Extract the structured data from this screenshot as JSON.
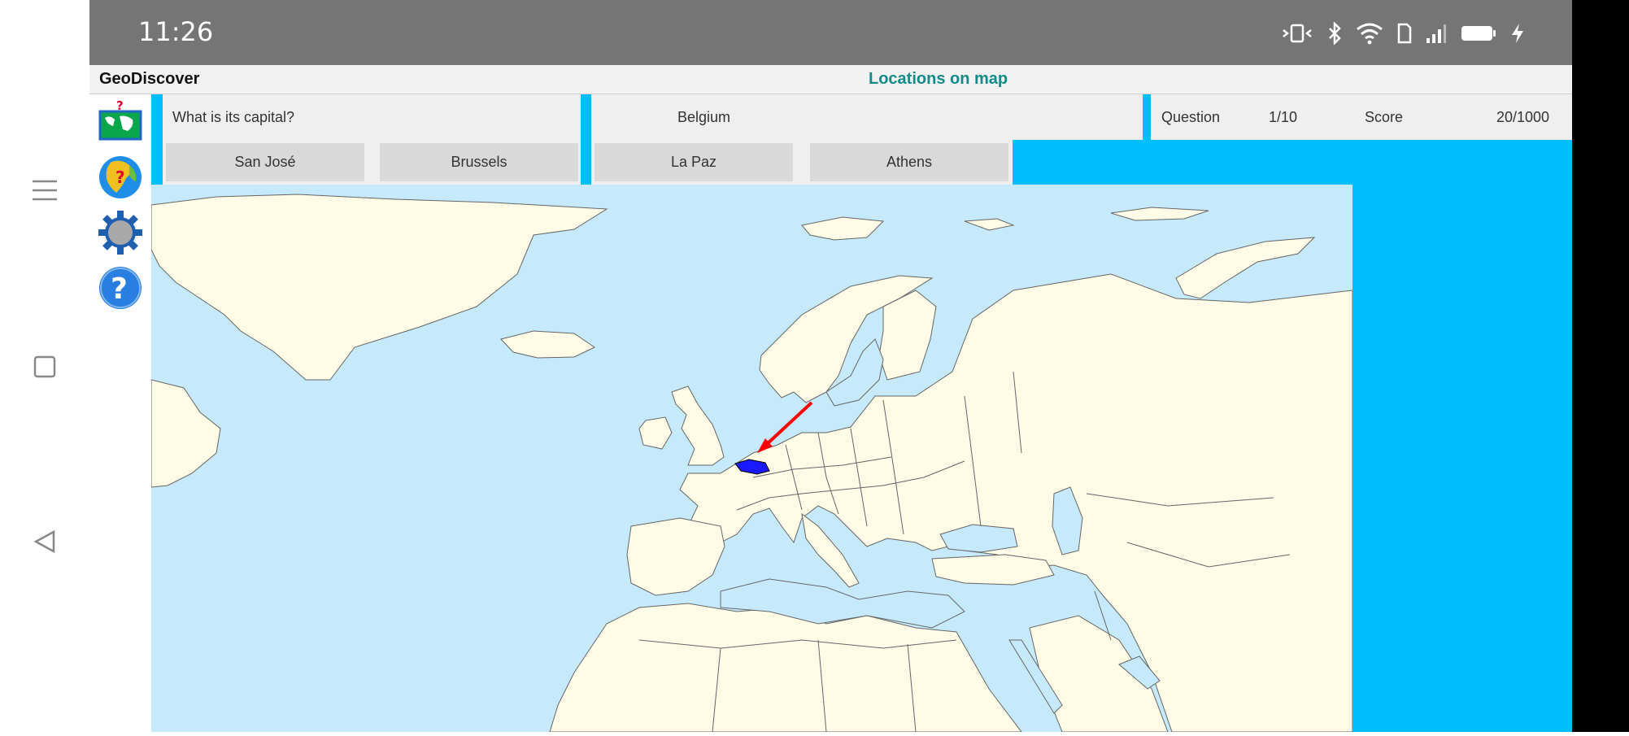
{
  "status_bar": {
    "time": "11:26",
    "icons": [
      "vibrate-icon",
      "bluetooth-icon",
      "wifi-icon",
      "sim-icon",
      "signal-icon",
      "battery-icon",
      "charging-icon"
    ]
  },
  "app": {
    "name": "GeoDiscover",
    "mode_title": "Locations on map"
  },
  "quiz": {
    "prompt": "What is its capital?",
    "subject": "Belgium",
    "question_label": "Question",
    "question_value": "1/10",
    "score_label": "Score",
    "score_value": "20/1000",
    "answers": [
      "San José",
      "Brussels",
      "La Paz",
      "Athens"
    ]
  },
  "tools": [
    {
      "name": "map-quiz-icon"
    },
    {
      "name": "globe-quiz-icon"
    },
    {
      "name": "settings-gear-icon"
    },
    {
      "name": "help-icon"
    }
  ],
  "colors": {
    "accent": "#00bfff",
    "sea": "#c6eafb",
    "land": "#fffbe6",
    "highlight_country": "#1a1aff",
    "pointer_arrow": "#ff0000",
    "mode_title": "#138a8a"
  }
}
